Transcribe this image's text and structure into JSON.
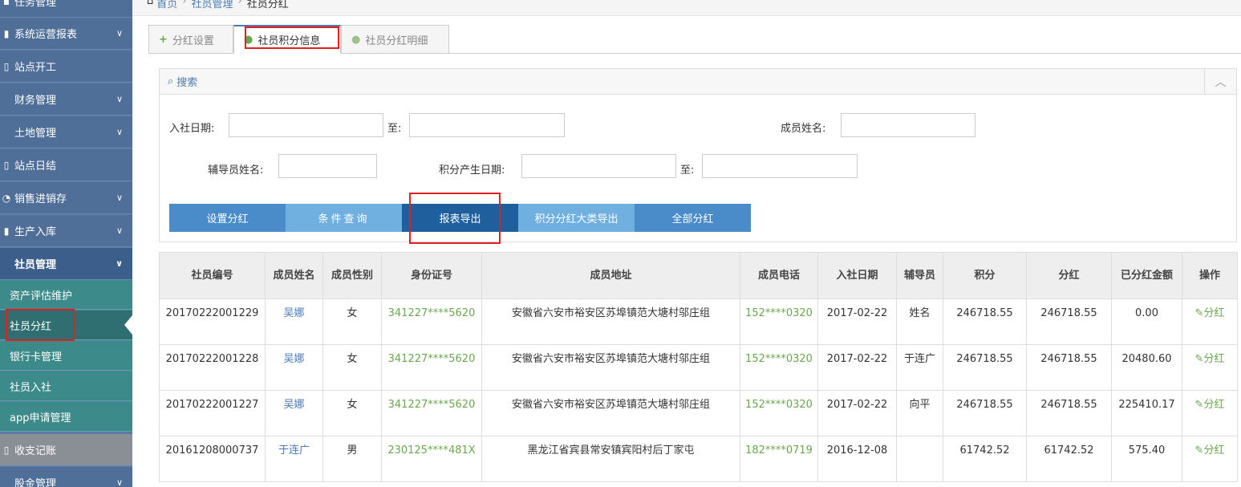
{
  "sidebar": {
    "items": [
      {
        "label": "任务管理",
        "icon": "task-icon",
        "chevron": false
      },
      {
        "label": "系统运营报表",
        "icon": "bar-chart-icon",
        "chevron": true
      },
      {
        "label": "站点开工",
        "icon": "file-icon",
        "chevron": false
      },
      {
        "label": "财务管理",
        "icon": "",
        "chevron": true
      },
      {
        "label": "土地管理",
        "icon": "",
        "chevron": true
      },
      {
        "label": "站点日结",
        "icon": "file-icon",
        "chevron": false
      },
      {
        "label": "销售进销存",
        "icon": "pie-icon",
        "chevron": true
      },
      {
        "label": "生产入库",
        "icon": "bar-chart-icon",
        "chevron": true
      },
      {
        "label": "社员管理",
        "icon": "",
        "chevron": true
      }
    ],
    "sub_items": [
      "资产评估维护",
      "社员分红",
      "银行卡管理",
      "社员入社",
      "app申请管理"
    ],
    "bottom_items": [
      "收支记账",
      "股金管理"
    ]
  },
  "breadcrumb": {
    "home": "首页",
    "level1": "社员管理",
    "current": "社员分红"
  },
  "tabs": [
    {
      "label": "分红设置"
    },
    {
      "label": "社员积分信息"
    },
    {
      "label": "社员分红明细"
    }
  ],
  "search": {
    "title": "搜索",
    "join_date_label": "入社日期:",
    "to_label": "至:",
    "member_name_label": "成员姓名:",
    "tutor_name_label": "辅导员姓名:",
    "points_date_label": "积分产生日期:"
  },
  "buttons": [
    "设置分红",
    "条件查询",
    "报表导出",
    "积分分红大类导出",
    "全部分红"
  ],
  "table": {
    "headers": [
      "社员编号",
      "成员姓名",
      "成员性别",
      "身份证号",
      "成员地址",
      "成员电话",
      "入社日期",
      "辅导员",
      "积分",
      "分红",
      "已分红金额",
      "操作"
    ],
    "rows": [
      [
        "20170222001229",
        "吴娜",
        "女",
        "341227****5620",
        "安徽省六安市裕安区苏埠镇范大塘村邬庄组",
        "152****0320",
        "2017-02-22",
        "姓名",
        "246718.55",
        "246718.55",
        "0.00",
        "分红"
      ],
      [
        "20170222001228",
        "吴娜",
        "女",
        "341227****5620",
        "安徽省六安市裕安区苏埠镇范大塘村邬庄组",
        "152****0320",
        "2017-02-22",
        "于连广",
        "246718.55",
        "246718.55",
        "20480.60",
        "分红"
      ],
      [
        "20170222001227",
        "吴娜",
        "女",
        "341227****5620",
        "安徽省六安市裕安区苏埠镇范大塘村邬庄组",
        "152****0320",
        "2017-02-22",
        "向平",
        "246718.55",
        "246718.55",
        "225410.17",
        "分红"
      ],
      [
        "20161208000737",
        "于连广",
        "男",
        "230125****481X",
        "黑龙江省宾县常安镇宾阳村后丁家屯",
        "182****0719",
        "2016-12-08",
        "",
        "61742.52",
        "61742.52",
        "575.40",
        "分红"
      ]
    ]
  }
}
